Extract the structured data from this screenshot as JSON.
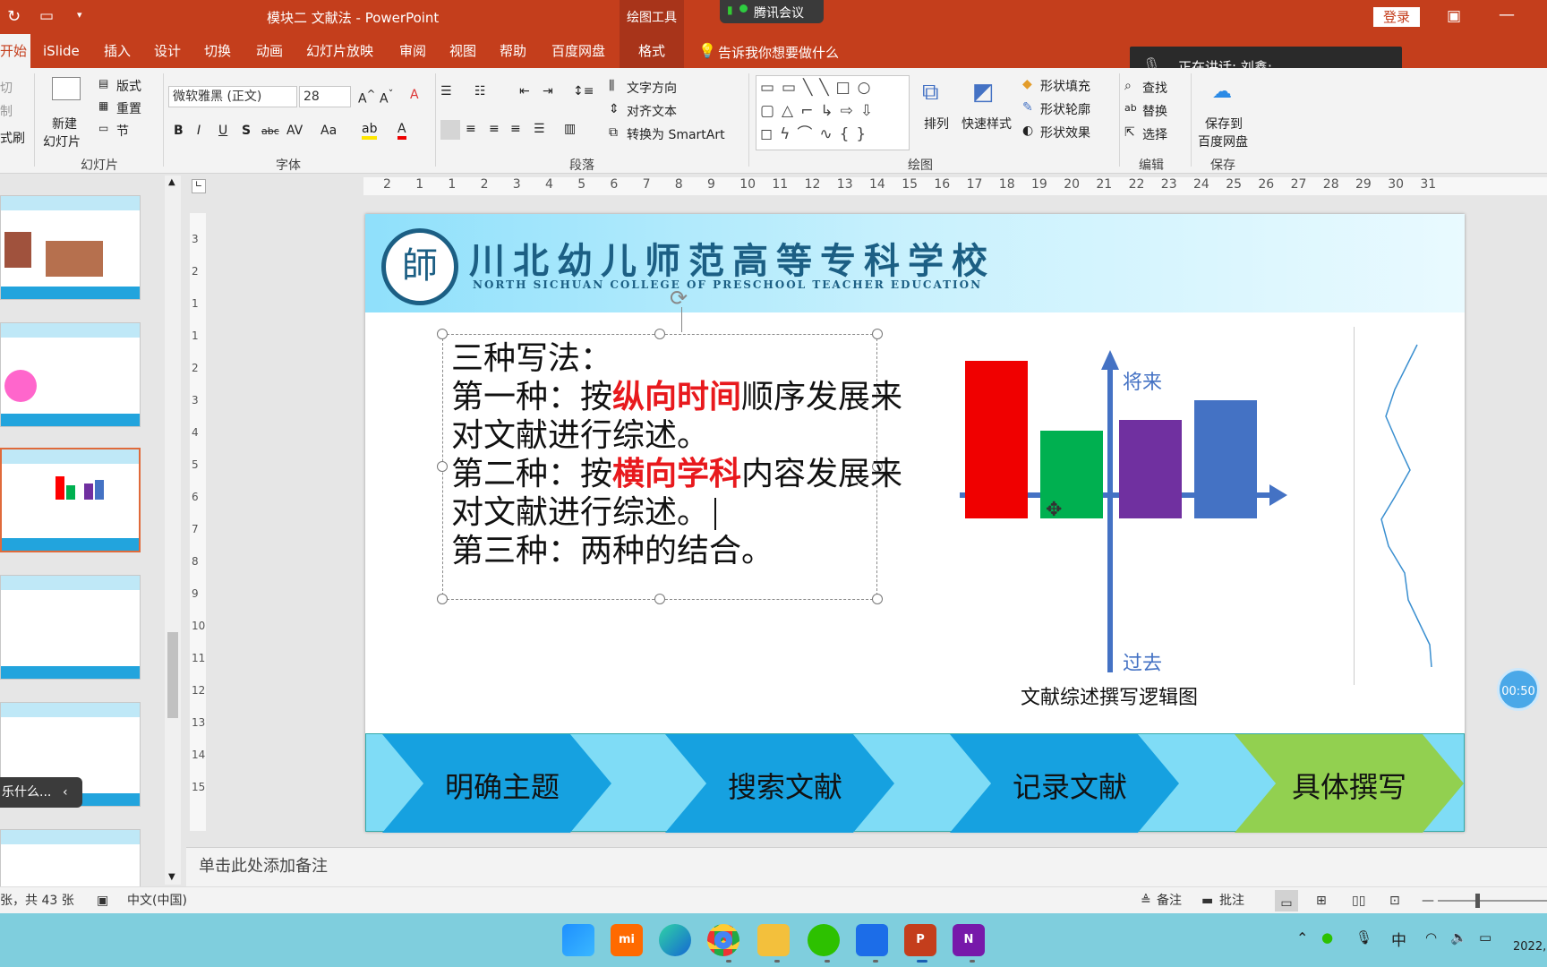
{
  "titlebar": {
    "doc_title": "模块二 文献法 - PowerPoint",
    "context_tab": "绘图工具",
    "meeting_label": "腾讯会议",
    "login_button": "登录"
  },
  "speaking_banner": {
    "text": "正在讲话: 刘鑫;"
  },
  "ribbon_tabs": [
    "开始",
    "iSlide",
    "插入",
    "设计",
    "切换",
    "动画",
    "幻灯片放映",
    "审阅",
    "视图",
    "帮助",
    "百度网盘",
    "格式"
  ],
  "tell_me": "告诉我你想要做什么",
  "ribbon": {
    "cut": "切",
    "copy": "制",
    "format_painter": "式刷",
    "new_slide": "新建",
    "new_slide_2": "幻灯片",
    "layout": "版式",
    "reset": "重置",
    "section": "节",
    "group_slides": "幻灯片",
    "font_name": "微软雅黑 (正文)",
    "font_size": "28",
    "group_font": "字体",
    "text_direction": "文字方向",
    "align_text": "对齐文本",
    "to_smartart": "转换为 SmartArt",
    "group_paragraph": "段落",
    "arrange": "排列",
    "quick_styles": "快速样式",
    "shape_fill": "形状填充",
    "shape_outline": "形状轮廓",
    "shape_effects": "形状效果",
    "group_drawing": "绘图",
    "find": "查找",
    "replace": "替换",
    "select": "选择",
    "group_edit": "编辑",
    "save_baidu_1": "保存到",
    "save_baidu_2": "百度网盘",
    "group_save": "保存"
  },
  "ruler": {
    "top_ticks": [
      "2",
      "1",
      "1",
      "2",
      "3",
      "4",
      "5",
      "6",
      "7",
      "8",
      "9",
      "10",
      "11",
      "12",
      "13",
      "14",
      "15",
      "16",
      "17",
      "18",
      "19",
      "20",
      "21",
      "22",
      "23",
      "24",
      "25",
      "26",
      "27",
      "28",
      "29",
      "30",
      "31"
    ],
    "left_ticks": [
      "3",
      "2",
      "1",
      "1",
      "2",
      "3",
      "4",
      "5",
      "6",
      "7",
      "8",
      "9",
      "10",
      "11",
      "12",
      "13",
      "14",
      "15"
    ]
  },
  "slide": {
    "school_name_cn": "川北幼儿师范高等专科学校",
    "school_name_en": "NORTH SICHUAN COLLEGE OF PRESCHOOL TEACHER EDUCATION",
    "logo_char": "師",
    "line1": "三种写法：",
    "line2_a": "第一种：按",
    "line2_b": "纵向时间",
    "line2_c": "顺序发展来",
    "line3": "对文献进行综述。",
    "line4_a": "第二种：按",
    "line4_b": "横向学科",
    "line4_c": "内容发展来",
    "line5": "对文献进行综述。",
    "line6": "第三种：两种的结合。",
    "axis_future": "将来",
    "axis_past": "过去",
    "diagram_caption": "文献综述撰写逻辑图",
    "colors": {
      "red_bar": "#f00000",
      "green_bar": "#00b050",
      "purple_bar": "#7030a0",
      "blue_bar": "#4472c4",
      "axis": "#4472c4"
    },
    "flow": [
      "明确主题",
      "搜索文献",
      "记录文献",
      "具体撰写"
    ]
  },
  "timer": "00:50",
  "notes_placeholder": "单击此处添加备注",
  "left_tooltip": "乐什么...",
  "status": {
    "slide_info": "张，共 43 张",
    "language": "中文(中国)",
    "notes": "备注",
    "comments": "批注"
  },
  "taskbar": {
    "ime": "中",
    "date": "2022,"
  }
}
